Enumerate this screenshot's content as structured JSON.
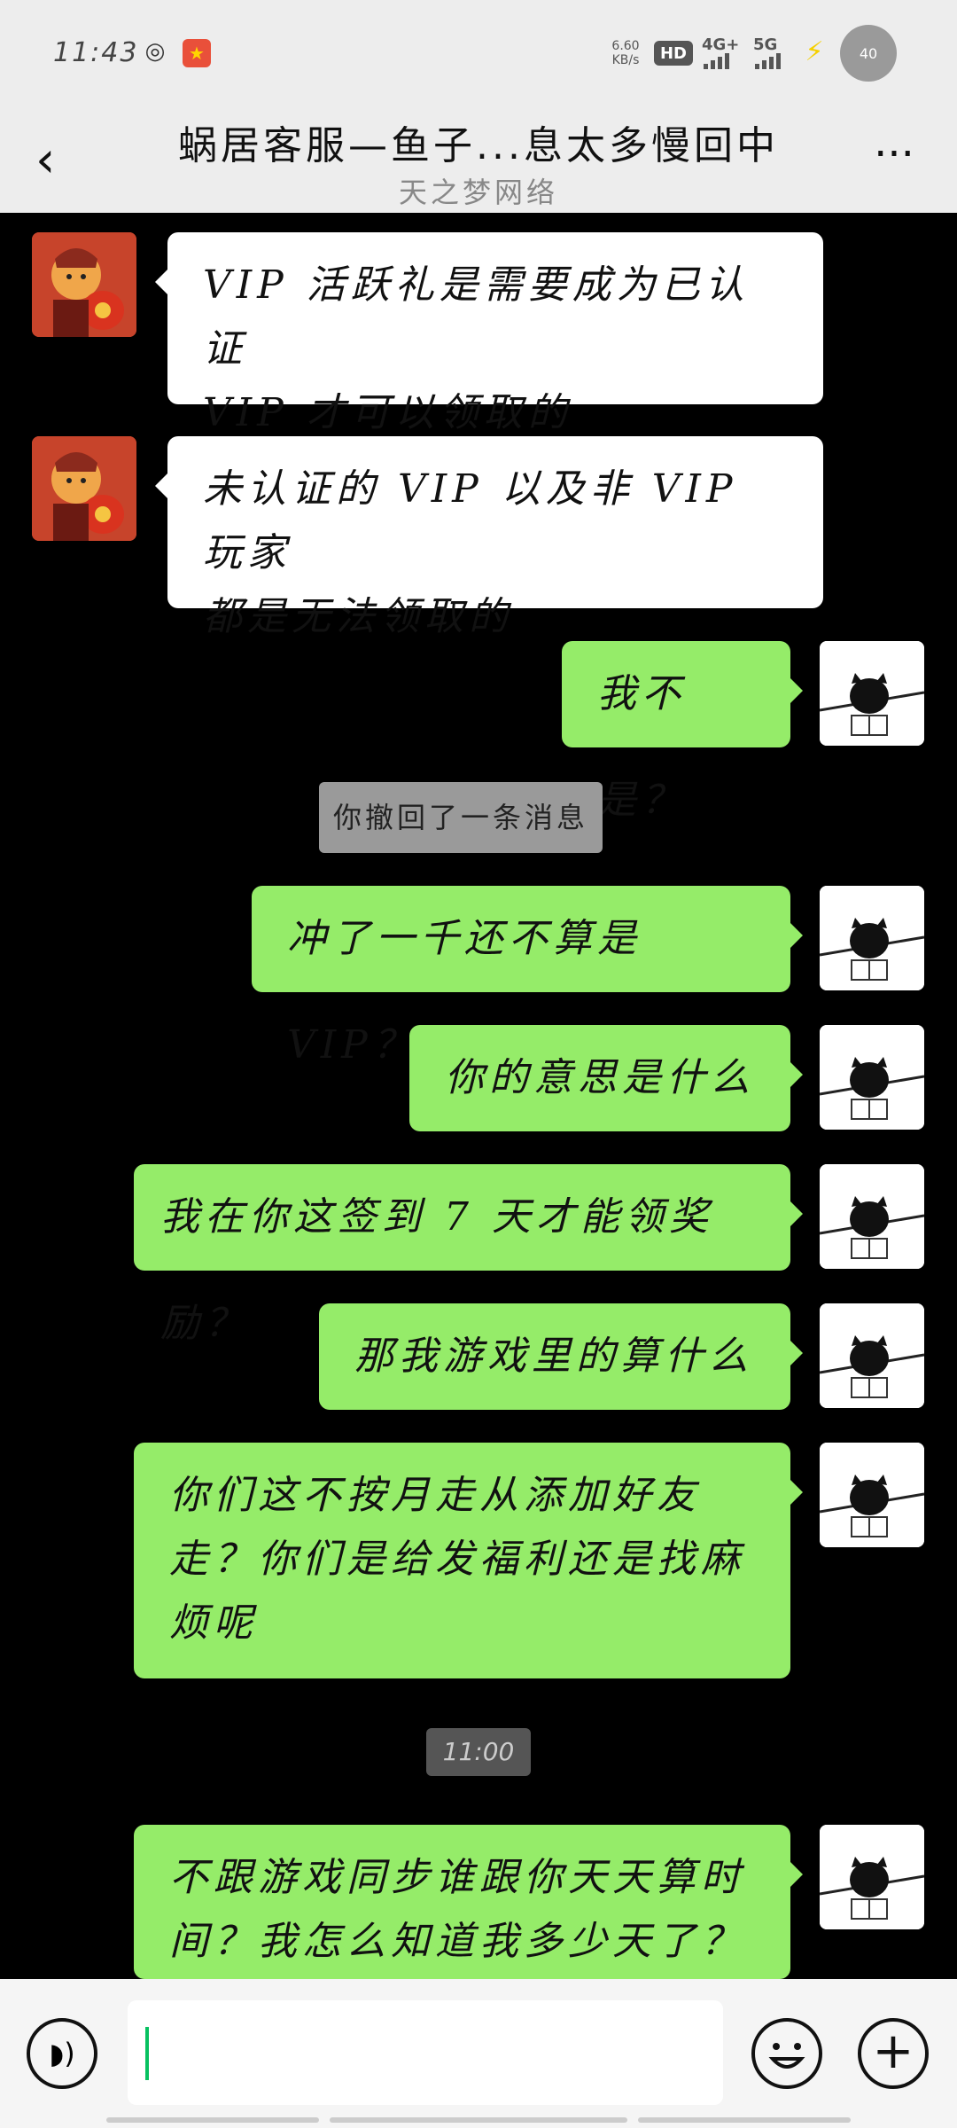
{
  "status_bar": {
    "time": "11:43",
    "net_speed_value": "6.60",
    "net_speed_unit": "KB/s",
    "hd_label": "HD",
    "sim1_label": "4G+",
    "sim2_label": "5G",
    "battery": "40"
  },
  "header": {
    "title": "蜗居客服—鱼子...息太多慢回中",
    "subtitle": "天之梦网络"
  },
  "messages": [
    {
      "side": "left",
      "lines": [
        "VIP 活跃礼是需要成为已认证",
        "VIP 才可以领取的"
      ]
    },
    {
      "side": "left",
      "lines": [
        "未认证的 VIP 以及非 VIP 玩家",
        "都是无法领取的"
      ]
    },
    {
      "side": "right",
      "lines": [
        "我不是？"
      ]
    },
    {
      "side": "system",
      "text": "你撤回了一条消息"
    },
    {
      "side": "right",
      "lines": [
        "冲了一千还不算是 VIP？"
      ]
    },
    {
      "side": "right",
      "lines": [
        "你的意思是什么"
      ]
    },
    {
      "side": "right",
      "lines": [
        "我在你这签到 7 天才能领奖励？"
      ]
    },
    {
      "side": "right",
      "lines": [
        "那我游戏里的算什么"
      ]
    },
    {
      "side": "right",
      "lines": [
        "你们这不按月走从添加好友",
        "走？你们是给发福利还是找麻",
        "烦呢"
      ]
    },
    {
      "side": "timestamp",
      "text": "11:00"
    },
    {
      "side": "right",
      "lines": [
        "不跟游戏同步谁跟你天天算时",
        "间？我怎么知道我多少天了？"
      ]
    }
  ],
  "input_bar": {
    "value": "",
    "voice_icon": "voice-icon",
    "emoji_icon": "emoji-icon",
    "plus_icon": "plus-icon"
  },
  "colors": {
    "header_bg": "#ededed",
    "chat_bg": "#000000",
    "outgoing_bubble": "#95ec69",
    "incoming_bubble": "#ffffff"
  }
}
